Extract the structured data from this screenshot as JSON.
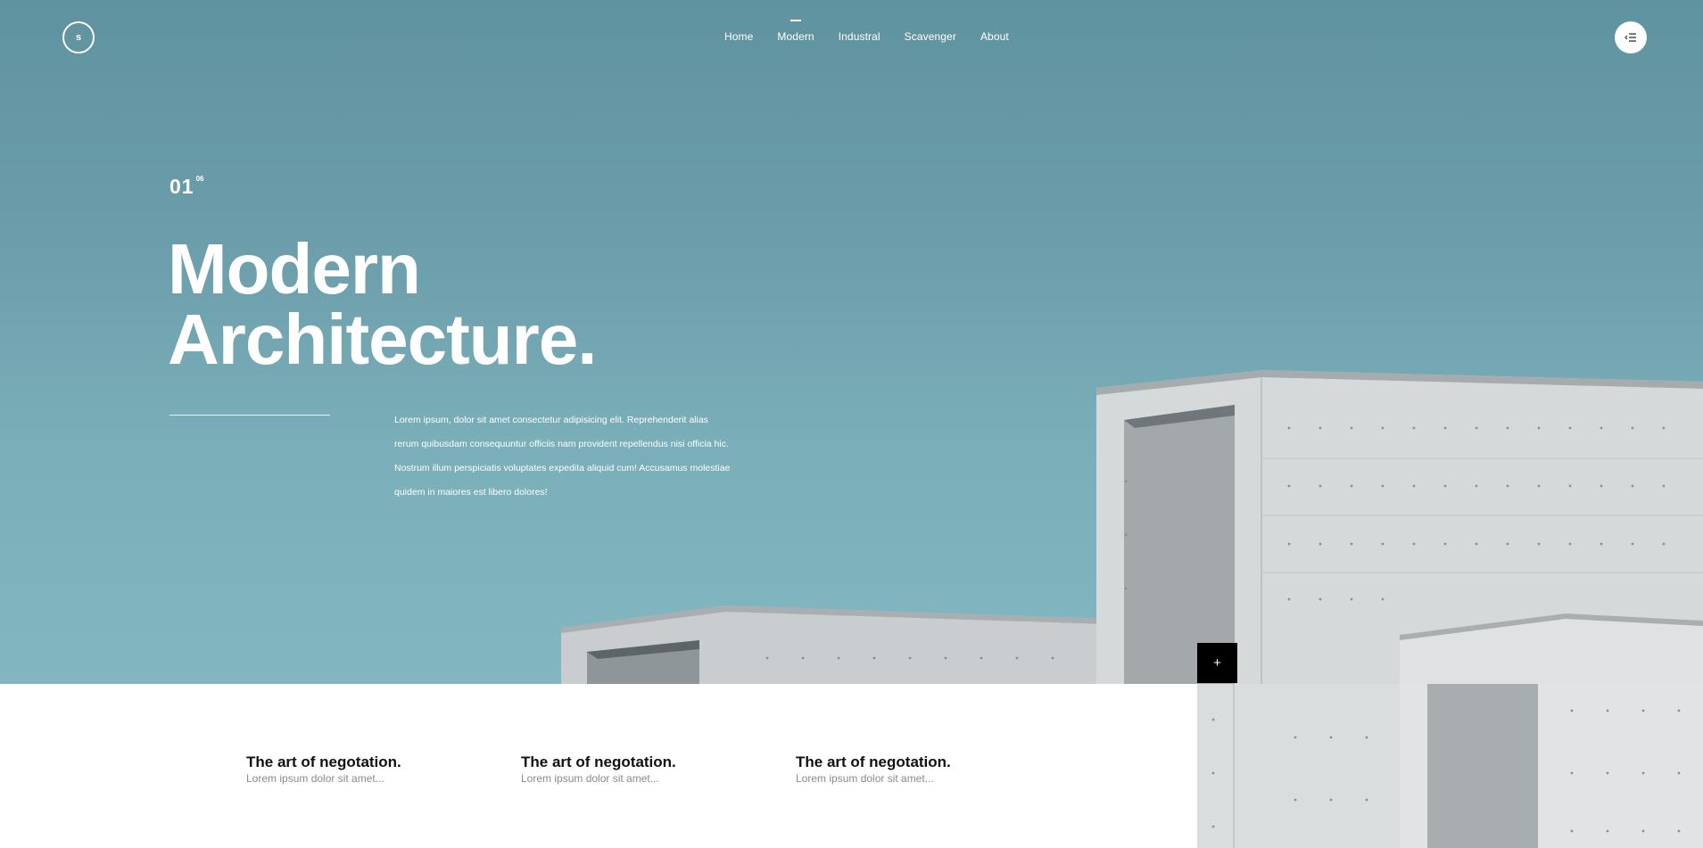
{
  "header": {
    "logo_letter": "s",
    "nav": [
      {
        "label": "Home",
        "active": false
      },
      {
        "label": "Modern",
        "active": true
      },
      {
        "label": "Industral",
        "active": false
      },
      {
        "label": "Scavenger",
        "active": false
      },
      {
        "label": "About",
        "active": false
      }
    ],
    "menu_icon": "menu-lines-icon"
  },
  "hero": {
    "counter_current": "01",
    "counter_total": "06",
    "title_line1": "Modern",
    "title_line2": "Architecture.",
    "description": "Lorem ipsum, dolor sit amet consectetur adipisicing elit. Reprehenderit alias rerum quibusdam consequuntur officiis nam provident repellendus nisi officia hic. Nostrum illum perspiciatis voluptates expedita aliquid cum! Accusamus molestiae quidem in maiores est libero dolores!",
    "expand_label": "+"
  },
  "cards": [
    {
      "title": "The art of negotation.",
      "subtitle": "Lorem ipsum dolor sit amet..."
    },
    {
      "title": "The art of negotation.",
      "subtitle": "Lorem ipsum dolor sit amet..."
    },
    {
      "title": "The art of negotation.",
      "subtitle": "Lorem ipsum dolor sit amet..."
    }
  ],
  "colors": {
    "sky_top": "#5f939f",
    "sky_bottom": "#82b6c0",
    "concrete": "#d5d8d9",
    "accent_button": "#000000"
  }
}
